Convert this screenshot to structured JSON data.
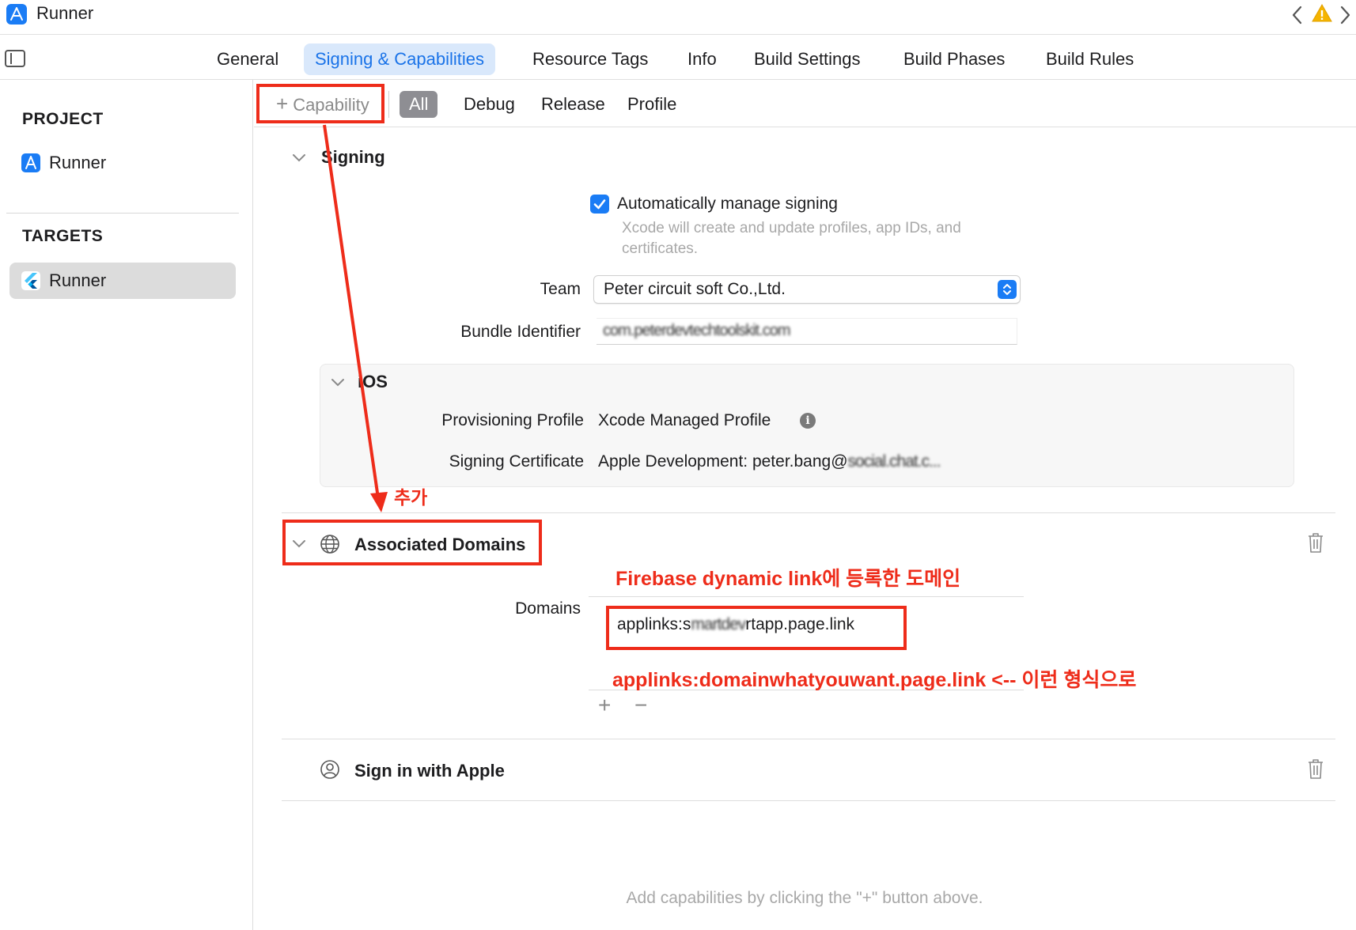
{
  "window": {
    "title": "Runner"
  },
  "tabs": [
    {
      "label": "General"
    },
    {
      "label": "Signing & Capabilities"
    },
    {
      "label": "Resource Tags"
    },
    {
      "label": "Info"
    },
    {
      "label": "Build Settings"
    },
    {
      "label": "Build Phases"
    },
    {
      "label": "Build Rules"
    }
  ],
  "active_tab": "Signing & Capabilities",
  "sidebar": {
    "project_heading": "PROJECT",
    "project_item": "Runner",
    "targets_heading": "TARGETS",
    "target_item": "Runner"
  },
  "subtabs": {
    "capability_label": "Capability",
    "items": [
      "All",
      "Debug",
      "Release",
      "Profile"
    ],
    "active": "All"
  },
  "signing": {
    "title": "Signing",
    "auto_manage_label": "Automatically manage signing",
    "auto_manage_checked": true,
    "auto_manage_note_line1": "Xcode will create and update profiles, app IDs, and",
    "auto_manage_note_line2": "certificates.",
    "team_label": "Team",
    "team_value": "Peter circuit soft Co.,Ltd.",
    "bundle_label": "Bundle Identifier",
    "bundle_value": "com.peterdevtechtoolskit.com",
    "ios": {
      "title": "iOS",
      "provisioning_label": "Provisioning Profile",
      "provisioning_value": "Xcode Managed Profile",
      "certificate_label": "Signing Certificate",
      "certificate_value_prefix": "Apple Development: peter.bang@",
      "certificate_value_hidden": "social.chat.c..."
    }
  },
  "associated_domains": {
    "title": "Associated Domains",
    "domains_label": "Domains",
    "entry_prefix": "applinks:s",
    "entry_hidden": "martdev",
    "entry_suffix": "rtapp.page.link"
  },
  "sign_in_with_apple": {
    "title": "Sign in with Apple"
  },
  "footer_hint": "Add capabilities by clicking the \"+\" button above.",
  "annotations": {
    "add_label": "추가",
    "firebase_note": "Firebase dynamic link에 등록한 도메인",
    "format_note": "applinks:domainwhatyouwant.page.link <-- 이런 형식으로"
  },
  "colors": {
    "accent": "#1a7cf5",
    "active_tab_bg": "#d9e8fb",
    "annotation_red": "#ee2c1a",
    "warning": "#f5b400"
  }
}
